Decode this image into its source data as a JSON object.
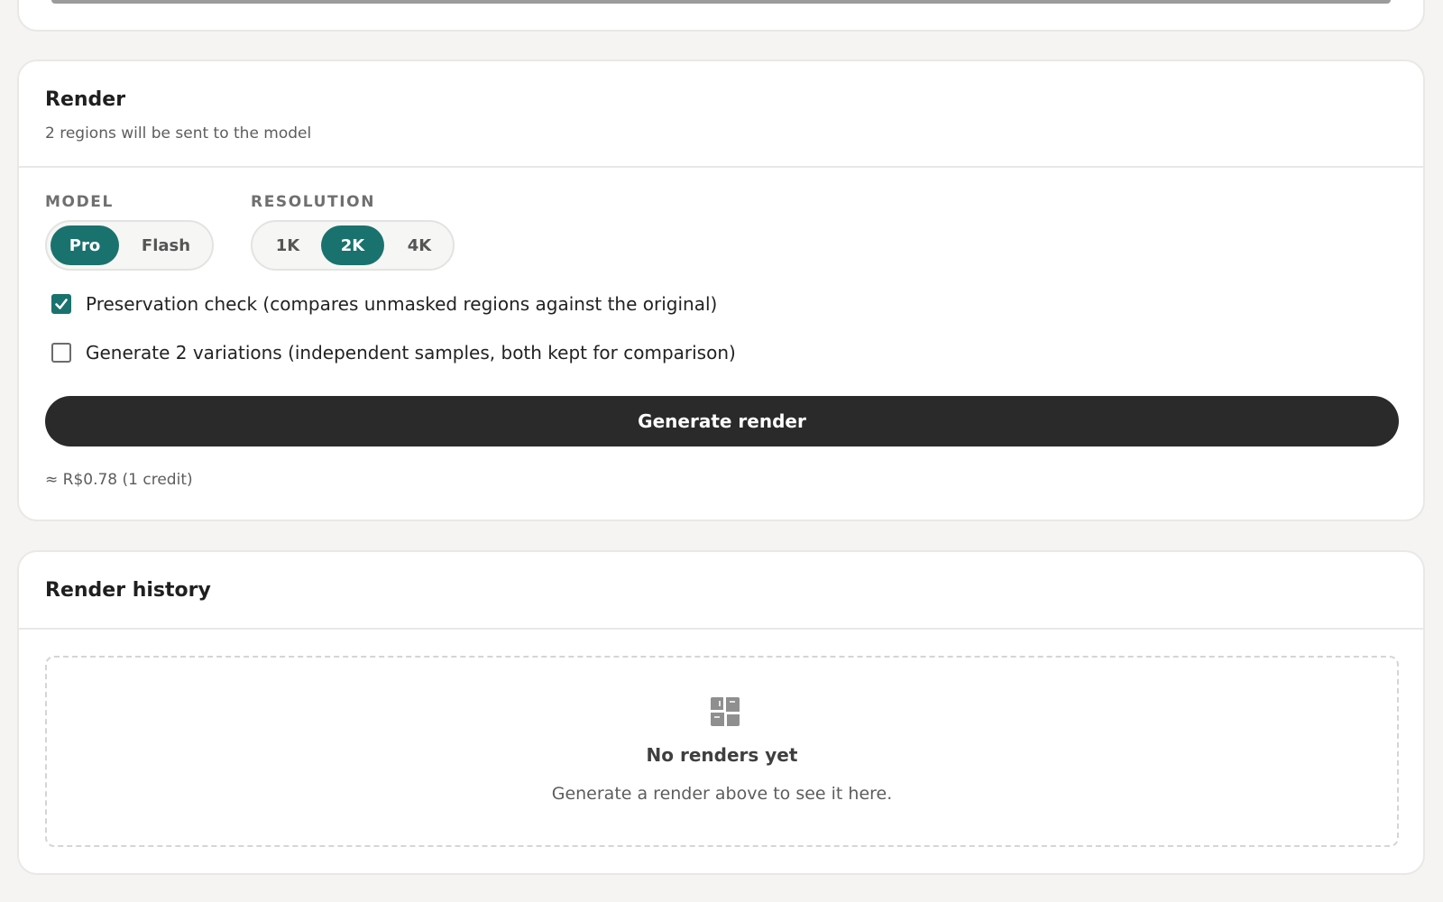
{
  "render": {
    "title": "Render",
    "subtitle": "2 regions will be sent to the model",
    "model_label": "MODEL",
    "model_options": [
      "Pro",
      "Flash"
    ],
    "model_selected": "Pro",
    "resolution_label": "RESOLUTION",
    "resolution_options": [
      "1K",
      "2K",
      "4K"
    ],
    "resolution_selected": "2K",
    "preservation_check": {
      "label": "Preservation check (compares unmasked regions against the original)",
      "checked": true
    },
    "variations": {
      "label": "Generate 2 variations (independent samples, both kept for comparison)",
      "checked": false
    },
    "generate_label": "Generate render",
    "cost_note": "≈ R$0.78 (1 credit)"
  },
  "history": {
    "title": "Render history",
    "empty_icon": "gallery-icon",
    "empty_title": "No renders yet",
    "empty_text": "Generate a render above to see it here."
  },
  "colors": {
    "accent": "#1a726e",
    "button_dark": "#2a2a2a",
    "background": "#f5f4f2"
  }
}
